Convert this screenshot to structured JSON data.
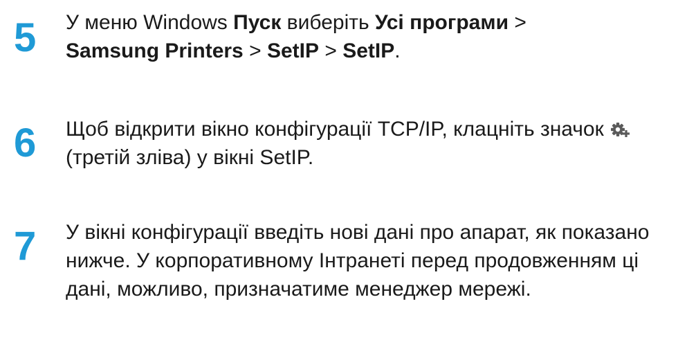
{
  "steps": [
    {
      "number": "5",
      "text": {
        "p1": "У меню Windows ",
        "b1": "Пуск",
        "p2": " виберіть ",
        "b2": "Усі програми",
        "p3": " > ",
        "b3": "Samsung Printers",
        "p4": " > ",
        "b4": "SetIP",
        "p5": " > ",
        "b5": "SetIP",
        "p6": "."
      }
    },
    {
      "number": "6",
      "text": {
        "p1": "Щоб відкрити вікно конфігурації TCP/IP, клацніть значок ",
        "icon": "tcpip-config-gear-icon",
        "p2": " (третій зліва) у вікні SetIP."
      }
    },
    {
      "number": "7",
      "text": "У вікні конфігурації введіть нові дані про апарат, як показано нижче. У корпоративному Інтранеті перед продовженням ці дані, можливо, призначатиме менеджер мережі."
    }
  ],
  "colors": {
    "step_number": "#1f9ad6",
    "body_text": "#1a1a1a",
    "icon_fill": "#5a5a5a"
  }
}
